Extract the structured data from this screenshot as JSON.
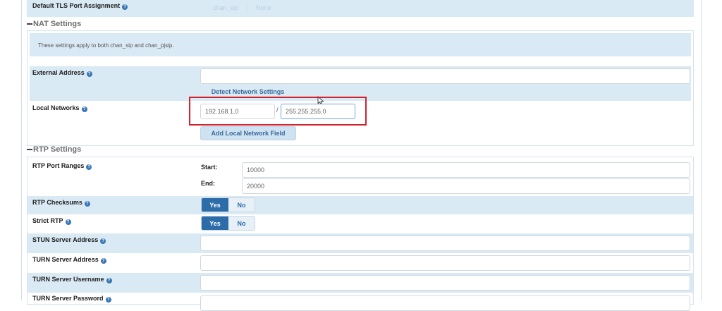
{
  "tls": {
    "label": "Default TLS Port Assignment",
    "options": [
      "chan_sip",
      "None"
    ]
  },
  "nat": {
    "title": "NAT Settings",
    "note": "These settings apply to both chan_sip and chan_pjsip.",
    "external_address": {
      "label": "External Address",
      "value": "",
      "detect_button": "Detect Network Settings"
    },
    "local_networks": {
      "label": "Local Networks",
      "network": "192.168.1.0",
      "separator": "/",
      "netmask": "255.255.255.0",
      "add_button": "Add Local Network Field"
    }
  },
  "rtp": {
    "title": "RTP Settings",
    "port_ranges": {
      "label": "RTP Port Ranges",
      "start_label": "Start:",
      "start_value": "10000",
      "end_label": "End:",
      "end_value": "20000"
    },
    "checksums": {
      "label": "RTP Checksums",
      "yes": "Yes",
      "no": "No"
    },
    "strict": {
      "label": "Strict RTP",
      "yes": "Yes",
      "no": "No"
    },
    "stun": {
      "label": "STUN Server Address",
      "value": ""
    },
    "turn": {
      "label": "TURN Server Address",
      "value": ""
    },
    "turn_user": {
      "label": "TURN Server Username",
      "value": ""
    },
    "turn_pass": {
      "label": "TURN Server Password"
    }
  },
  "colors": {
    "band": "#daeaf5",
    "primary": "#2c6ca8",
    "highlight": "#d3212d"
  }
}
